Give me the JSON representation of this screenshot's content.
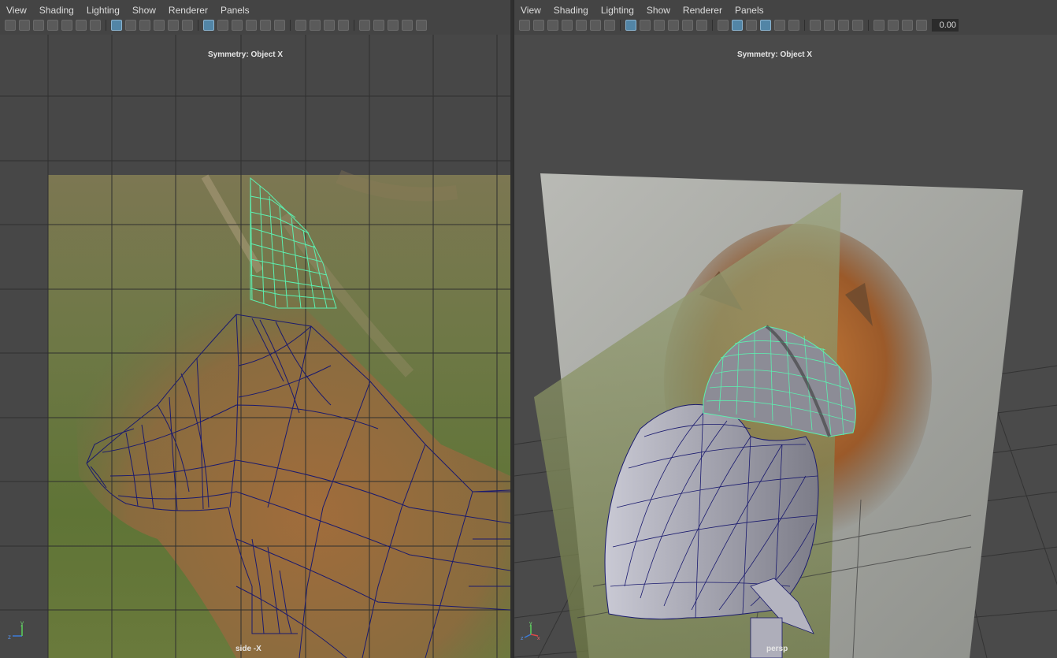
{
  "left_panel": {
    "menu": [
      "View",
      "Shading",
      "Lighting",
      "Show",
      "Renderer",
      "Panels"
    ],
    "symmetry_label": "Symmetry: Object X",
    "camera_label": "side -X",
    "axis": {
      "up": "y",
      "side": "z"
    }
  },
  "right_panel": {
    "menu": [
      "View",
      "Shading",
      "Lighting",
      "Show",
      "Renderer",
      "Panels"
    ],
    "symmetry_label": "Symmetry: Object X",
    "camera_label": "persp",
    "value_field": "0.00",
    "axis": {
      "up": "y",
      "side": "z",
      "depth": "x"
    }
  },
  "colors": {
    "wire": "#1a1a6e",
    "selected_wire": "#5cf0b0",
    "grid": "#2f2f2f",
    "viewport_bg": "#474747"
  },
  "toolbar_icons": [
    "camera-icon",
    "bookmark-icon",
    "image-plane-icon",
    "grid-icon",
    "film-gate-icon",
    "resolution-gate-icon",
    "wireframe-icon",
    "smooth-shade-icon",
    "textured-icon",
    "lights-icon",
    "shadows-icon",
    "isolate-icon",
    "xray-icon",
    "exposure-icon"
  ]
}
